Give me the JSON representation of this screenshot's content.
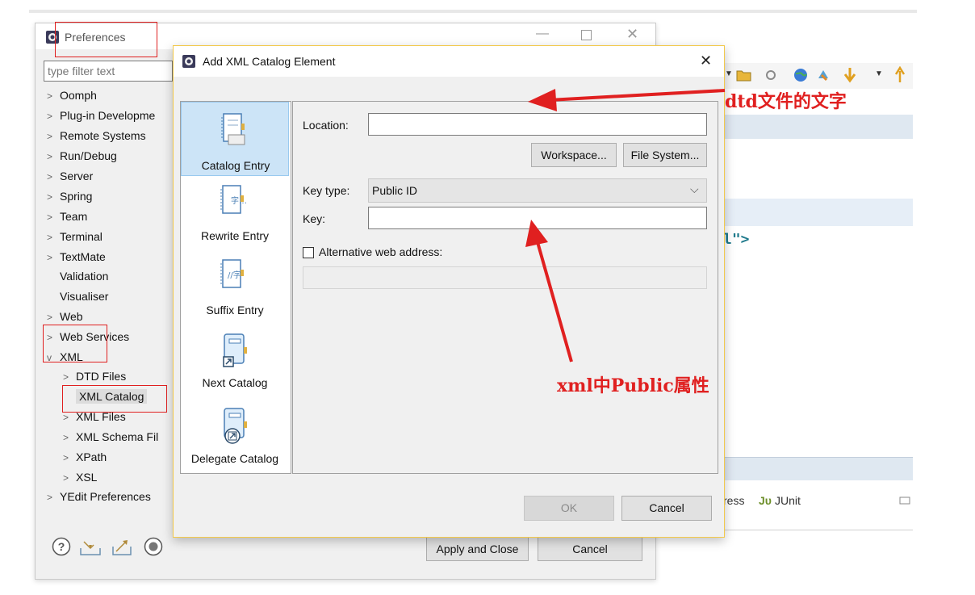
{
  "background_ide": {
    "toolbar_icons": [
      "dropdown-arrow-icon",
      "folder-open-icon",
      "separator",
      "tool-icon",
      "globe-icon",
      "refresh-icon",
      "down-arrow-icon",
      "dropdown-arrow-icon",
      "up-arrow-icon"
    ],
    "code_fragment": "l\">",
    "bottom_tabs": {
      "progress_tail": "ress",
      "junit_icon": "Jυ",
      "junit_label": "JUnit"
    }
  },
  "preferences": {
    "title": "Preferences",
    "filter_placeholder": "type filter text",
    "tree": [
      {
        "label": "Oomph",
        "chevron": ">"
      },
      {
        "label": "Plug-in Developme",
        "chevron": ">"
      },
      {
        "label": "Remote Systems",
        "chevron": ">"
      },
      {
        "label": "Run/Debug",
        "chevron": ">"
      },
      {
        "label": "Server",
        "chevron": ">"
      },
      {
        "label": "Spring",
        "chevron": ">"
      },
      {
        "label": "Team",
        "chevron": ">"
      },
      {
        "label": "Terminal",
        "chevron": ">"
      },
      {
        "label": "TextMate",
        "chevron": ">"
      },
      {
        "label": "Validation",
        "chevron": ""
      },
      {
        "label": "Visualiser",
        "chevron": ""
      },
      {
        "label": "Web",
        "chevron": ">"
      },
      {
        "label": "Web Services",
        "chevron": ">"
      },
      {
        "label": "XML",
        "chevron": "v"
      },
      {
        "label": "DTD Files",
        "chevron": ">"
      },
      {
        "label": "XML Catalog",
        "chevron": ""
      },
      {
        "label": "XML Files",
        "chevron": ">"
      },
      {
        "label": "XML Schema Fil",
        "chevron": ">"
      },
      {
        "label": "XPath",
        "chevron": ">"
      },
      {
        "label": "XSL",
        "chevron": ">"
      },
      {
        "label": "YEdit Preferences",
        "chevron": ">"
      }
    ],
    "apply_close_label": "Apply and Close",
    "cancel_label": "Cancel",
    "footer_icons": [
      "help-icon",
      "import-icon",
      "export-icon",
      "record-icon"
    ]
  },
  "dialog": {
    "title": "Add XML Catalog Element",
    "close_glyph": "✕",
    "sidebar": [
      {
        "label": "Catalog Entry",
        "icon": "catalog-entry-icon",
        "selected": true
      },
      {
        "label": "Rewrite Entry",
        "icon": "rewrite-entry-icon",
        "selected": false
      },
      {
        "label": "Suffix Entry",
        "icon": "suffix-entry-icon",
        "selected": false
      },
      {
        "label": "Next Catalog",
        "icon": "next-catalog-icon",
        "selected": false
      },
      {
        "label": "Delegate Catalog",
        "icon": "delegate-catalog-icon",
        "selected": false
      }
    ],
    "location_label": "Location:",
    "location_value": "",
    "workspace_label": "Workspace...",
    "file_system_label": "File System...",
    "key_type_label": "Key type:",
    "key_type_value": "Public ID",
    "key_label": "Key:",
    "key_value": "",
    "alt_web_label": "Alternative web address:",
    "alt_web_checked": false,
    "ok_label": "OK",
    "cancel_label": "Cancel"
  },
  "annotations": {
    "dtd_text": "dtd文件的文字",
    "public_text": "xml中Public属性",
    "color": "#e02020"
  }
}
